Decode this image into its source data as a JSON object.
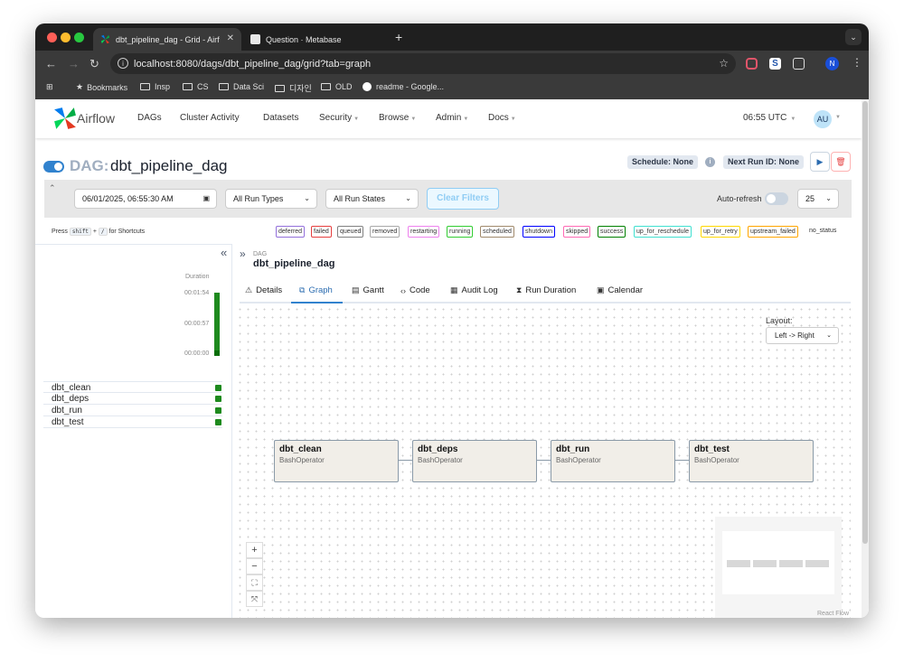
{
  "browser": {
    "tabs": [
      {
        "title": "dbt_pipeline_dag - Grid - Airf",
        "active": true
      },
      {
        "title": "Question · Metabase",
        "active": false
      }
    ],
    "url": "localhost:8080/dags/dbt_pipeline_dag/grid?tab=graph",
    "profile_initial": "N",
    "bookmarks": [
      {
        "label": "Bookmarks",
        "icon": "star-icon"
      },
      {
        "label": "Insp",
        "icon": "folder-icon"
      },
      {
        "label": "CS",
        "icon": "folder-icon"
      },
      {
        "label": "Data Sci",
        "icon": "folder-icon"
      },
      {
        "label": "디자인",
        "icon": "folder-icon"
      },
      {
        "label": "OLD",
        "icon": "folder-icon"
      },
      {
        "label": "readme - Google...",
        "icon": "google-icon"
      }
    ]
  },
  "navbar": {
    "brand": "Airflow",
    "links": [
      "DAGs",
      "Cluster Activity",
      "Datasets",
      "Security",
      "Browse",
      "Admin",
      "Docs"
    ],
    "time": "06:55 UTC",
    "user_initials": "AU"
  },
  "dag": {
    "prefix": "DAG:",
    "name": "dbt_pipeline_dag",
    "paused": false,
    "schedule": "Schedule: None",
    "next_run": "Next Run ID: None"
  },
  "filters": {
    "date": "06/01/2025, 06:55:30 AM",
    "run_types": "All Run Types",
    "run_states": "All Run States",
    "clear": "Clear Filters",
    "autorefresh": "Auto-refresh",
    "limit": "25"
  },
  "shortcuts": {
    "press": "Press",
    "key1": "shift",
    "plus": "+",
    "key2": "/",
    "suffix": "for Shortcuts"
  },
  "states": [
    {
      "label": "deferred",
      "color": "#9370db"
    },
    {
      "label": "failed",
      "color": "#e53e3e"
    },
    {
      "label": "queued",
      "color": "#808080"
    },
    {
      "label": "removed",
      "color": "#a9a9a9"
    },
    {
      "label": "restarting",
      "color": "#ee82ee"
    },
    {
      "label": "running",
      "color": "#32cd32"
    },
    {
      "label": "scheduled",
      "color": "#a0896b"
    },
    {
      "label": "shutdown",
      "color": "#0000ff"
    },
    {
      "label": "skipped",
      "color": "#ff69b4"
    },
    {
      "label": "success",
      "color": "#008000"
    },
    {
      "label": "up_for_reschedule",
      "color": "#40e0d0"
    },
    {
      "label": "up_for_retry",
      "color": "#ffd700"
    },
    {
      "label": "upstream_failed",
      "color": "#ffa500"
    },
    {
      "label": "no_status",
      "color": null
    }
  ],
  "grid": {
    "duration_label": "Duration",
    "ticks": [
      "00:01:54",
      "00:00:57",
      "00:00:00"
    ],
    "tasks": [
      "dbt_clean",
      "dbt_deps",
      "dbt_run",
      "dbt_test"
    ],
    "task_status_color": "#1e8a1e"
  },
  "detail": {
    "dag_label": "DAG",
    "dag_name": "dbt_pipeline_dag",
    "tabs": [
      {
        "label": "Details",
        "icon": "warning-triangle-icon"
      },
      {
        "label": "Graph",
        "icon": "graph-icon"
      },
      {
        "label": "Gantt",
        "icon": "gantt-icon"
      },
      {
        "label": "Code",
        "icon": "code-icon"
      },
      {
        "label": "Audit Log",
        "icon": "document-icon"
      },
      {
        "label": "Run Duration",
        "icon": "hourglass-icon"
      },
      {
        "label": "Calendar",
        "icon": "calendar-icon"
      }
    ],
    "active_tab": "Graph"
  },
  "graph": {
    "layout_label": "Layout:",
    "layout_value": "Left -> Right",
    "nodes": [
      {
        "name": "dbt_clean",
        "operator": "BashOperator"
      },
      {
        "name": "dbt_deps",
        "operator": "BashOperator"
      },
      {
        "name": "dbt_run",
        "operator": "BashOperator"
      },
      {
        "name": "dbt_test",
        "operator": "BashOperator"
      }
    ],
    "attribution": "React Flow"
  }
}
